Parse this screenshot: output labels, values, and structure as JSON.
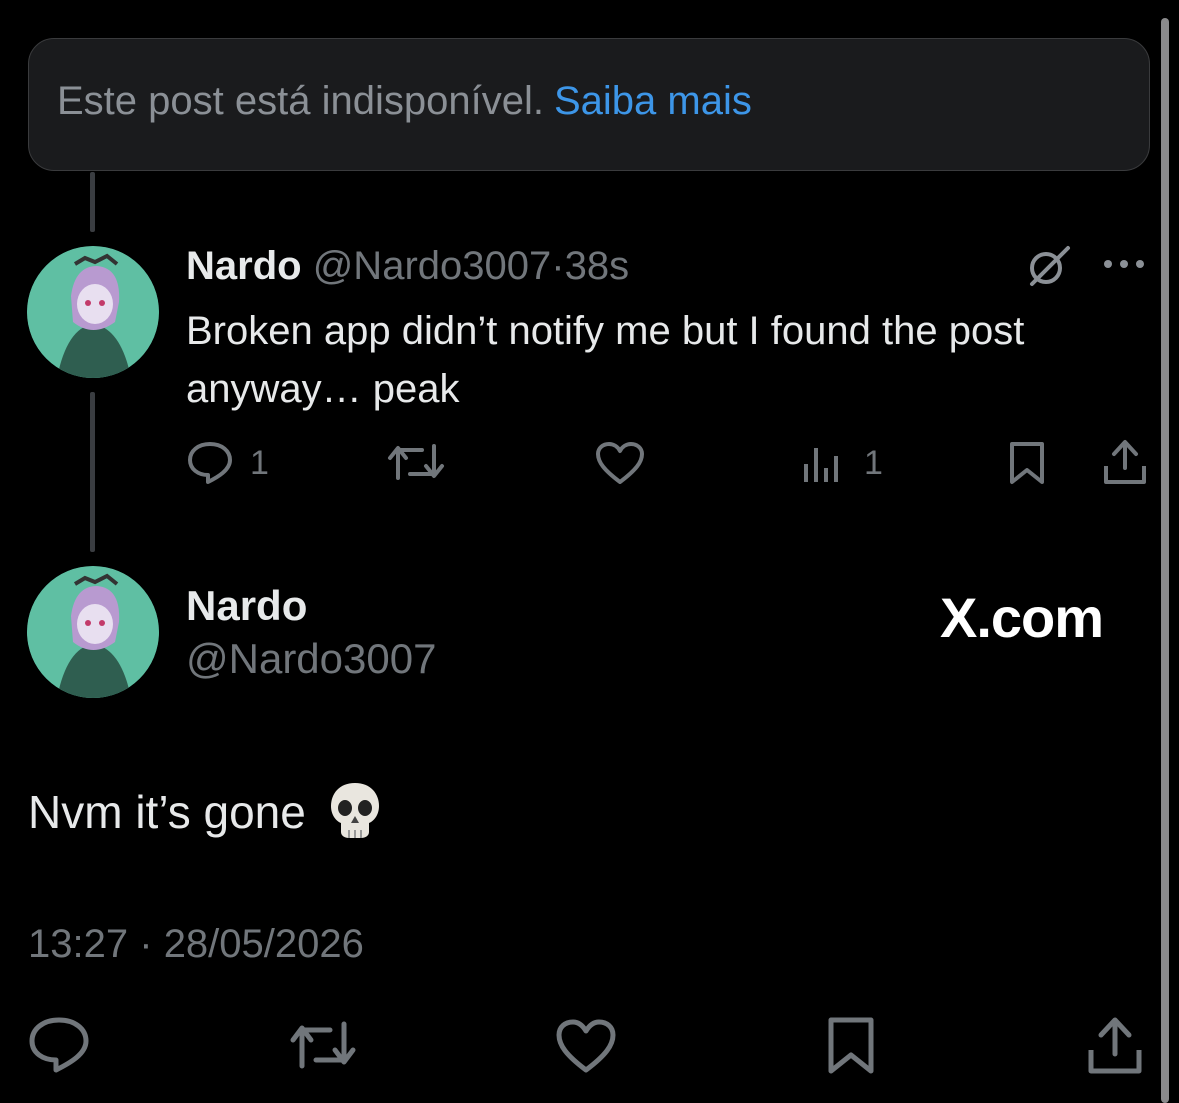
{
  "notice": {
    "text": "Este post está indisponível.",
    "link": "Saiba mais"
  },
  "reply": {
    "display_name": "Nardo",
    "handle": "@Nardo3007",
    "separator": "·",
    "time": "38s",
    "text": "Broken app didn’t notify me but I found the post anyway… peak",
    "replies_count": "1",
    "views_count": "1"
  },
  "main_post": {
    "display_name": "Nardo",
    "handle": "@Nardo3007",
    "brand": "X.com",
    "text": "Nvm it’s gone",
    "emoji": "skull",
    "time": "13:27",
    "separator": "·",
    "date": "28/05/2026"
  },
  "colors": {
    "link": "#3d96e8",
    "muted": "#71767b",
    "text": "#e7e9ea",
    "background": "#000000"
  },
  "icons": [
    "reply-icon",
    "retweet-icon",
    "like-icon",
    "views-icon",
    "bookmark-icon",
    "share-icon",
    "grok-icon",
    "more-icon"
  ]
}
